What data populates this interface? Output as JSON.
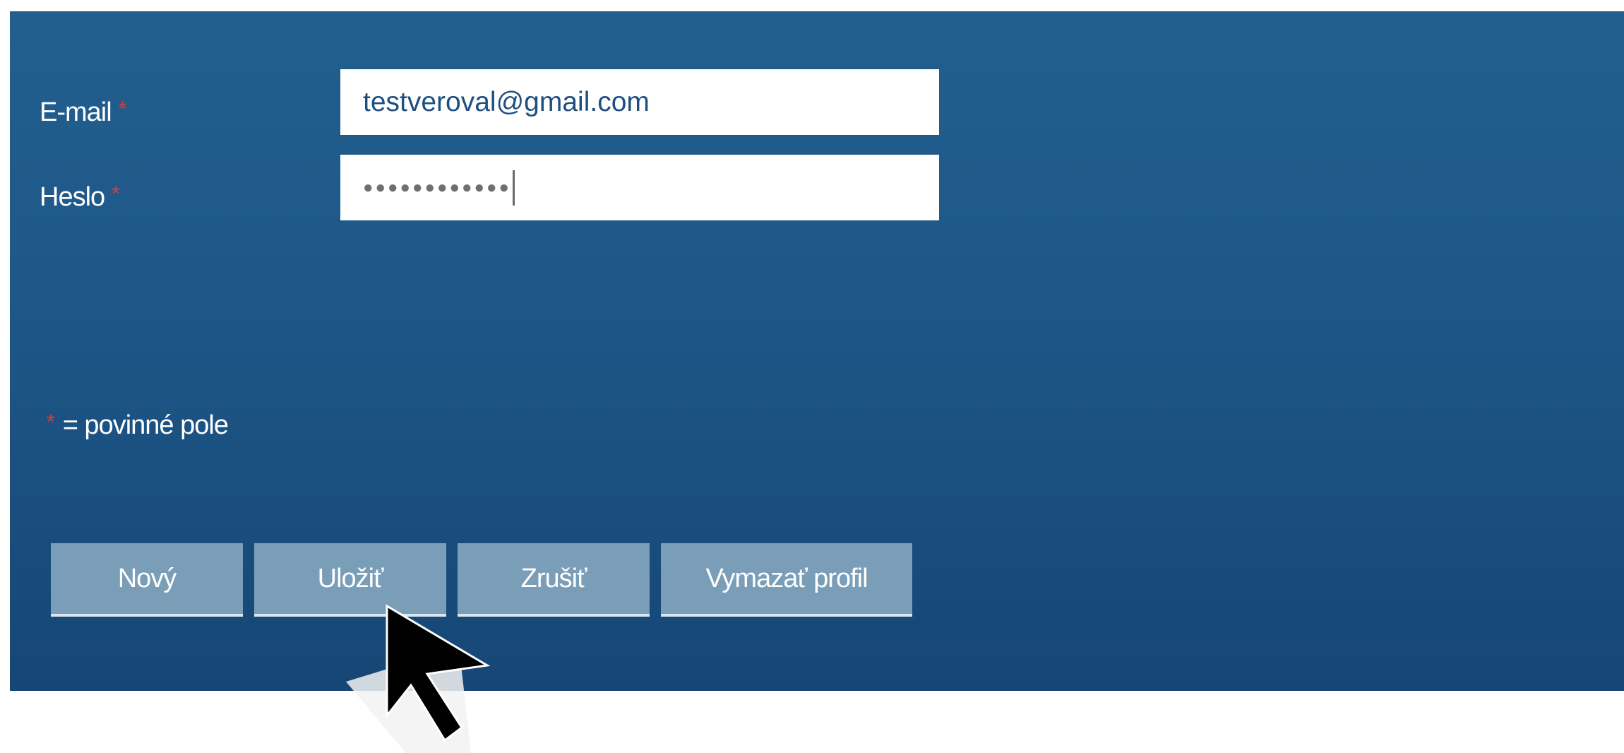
{
  "form": {
    "email_label": "E-mail",
    "password_label": "Heslo",
    "required_mark": "*",
    "email_value": "testveroval@gmail.com",
    "password_mask": "●●●●●●●●●●●●",
    "legend_text": "= povinné pole"
  },
  "buttons": {
    "new": "Nový",
    "save": "Uložiť",
    "cancel": "Zrušiť",
    "delete_profile": "Vymazať profil"
  },
  "colors": {
    "panel_top": "#225f8e",
    "panel_bottom": "#164675",
    "button_bg": "#7a9db8",
    "required": "#e23a3a",
    "input_text": "#1e4f80"
  },
  "cursor": {
    "icon": "mouse-pointer-icon"
  }
}
